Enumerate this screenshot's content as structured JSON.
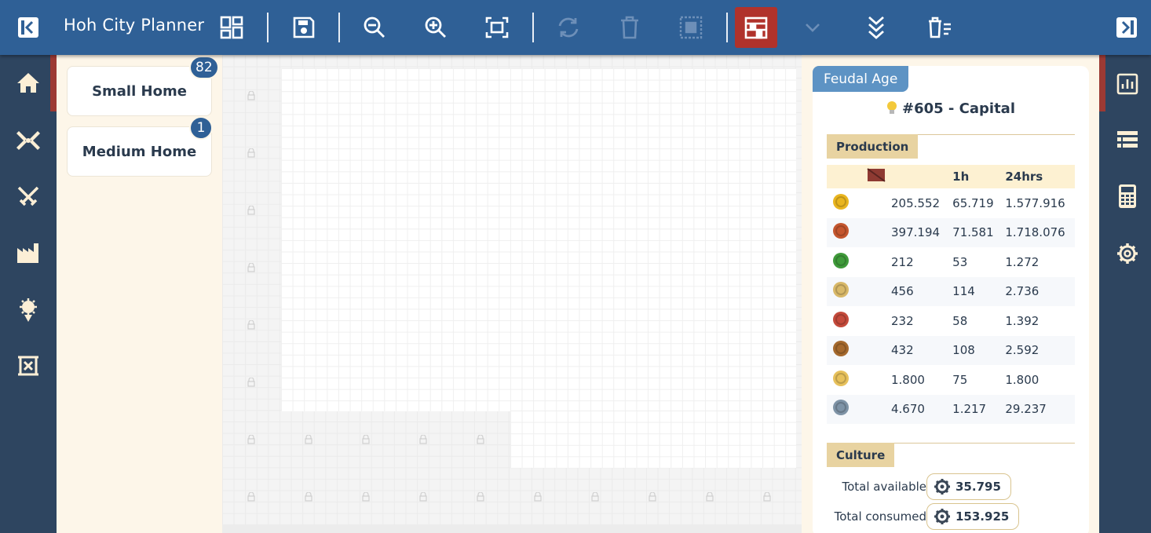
{
  "app": {
    "title": "Hoh City Planner"
  },
  "toolbar": {
    "buttons": [
      {
        "name": "collapse-left-icon",
        "enabled": true
      },
      {
        "name": "layout-grid-icon",
        "enabled": true
      },
      {
        "name": "save-icon",
        "enabled": true
      },
      {
        "name": "zoom-out-icon",
        "enabled": true
      },
      {
        "name": "zoom-in-icon",
        "enabled": true
      },
      {
        "name": "fit-screen-icon",
        "enabled": true
      },
      {
        "name": "rotate-icon",
        "enabled": false
      },
      {
        "name": "delete-icon",
        "enabled": false
      },
      {
        "name": "select-area-icon",
        "enabled": false
      },
      {
        "name": "building-stack-icon",
        "enabled": true,
        "active": true
      },
      {
        "name": "chevron-down-icon",
        "enabled": false
      },
      {
        "name": "double-chevron-down-icon",
        "enabled": true
      },
      {
        "name": "delete-list-icon",
        "enabled": true
      },
      {
        "name": "collapse-right-icon",
        "enabled": true
      }
    ]
  },
  "left_nav": [
    "home-icon",
    "windmill-icon",
    "crossed-swords-icon",
    "factory-icon",
    "culture-icon",
    "scroll-icon"
  ],
  "right_nav": [
    "stats-chart-icon",
    "list-icon",
    "calculator-icon",
    "settings-icon"
  ],
  "buildings": [
    {
      "label": "Small Home",
      "count": "82"
    },
    {
      "label": "Medium Home",
      "count": "1"
    }
  ],
  "stats": {
    "age": "Feudal Age",
    "city_name": "#605 - Capital",
    "production": {
      "title": "Production",
      "headers": [
        "",
        "1h",
        "24hrs"
      ],
      "rows": [
        {
          "icon": "coins-icon",
          "color": "#e9b51f",
          "values": [
            "205.552",
            "65.719",
            "1.577.916"
          ]
        },
        {
          "icon": "food-icon",
          "color": "#c4562e",
          "values": [
            "397.194",
            "71.581",
            "1.718.076"
          ]
        },
        {
          "icon": "herb-icon",
          "color": "#3f9a3a",
          "values": [
            "212",
            "53",
            "1.272"
          ]
        },
        {
          "icon": "parchment-icon",
          "color": "#d8b868",
          "values": [
            "456",
            "114",
            "2.736"
          ]
        },
        {
          "icon": "dye-icon",
          "color": "#c44a3b",
          "values": [
            "232",
            "58",
            "1.392"
          ]
        },
        {
          "icon": "barrel-icon",
          "color": "#a5692d",
          "values": [
            "432",
            "108",
            "2.592"
          ]
        },
        {
          "icon": "wool-icon",
          "color": "#e7c15c",
          "values": [
            "1.800",
            "75",
            "1.800"
          ]
        },
        {
          "icon": "tools-icon",
          "color": "#7e93a6",
          "values": [
            "4.670",
            "1.217",
            "29.237"
          ]
        }
      ]
    },
    "culture": {
      "title": "Culture",
      "rows": [
        {
          "label": "Total available",
          "value": "35.795"
        },
        {
          "label": "Total consumed",
          "value": "153.925"
        }
      ]
    }
  }
}
